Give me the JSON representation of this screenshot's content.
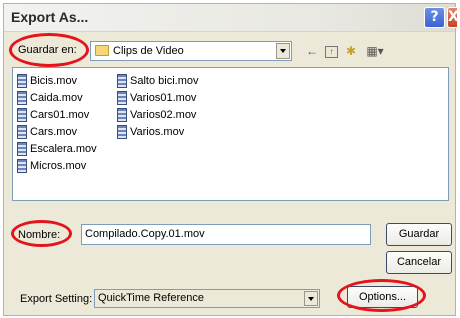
{
  "window": {
    "title": "Export As..."
  },
  "titlebar": {
    "help_glyph": "?",
    "close_glyph": "X"
  },
  "save_in": {
    "label": "Guardar en:",
    "value": "Clips de Video"
  },
  "files": {
    "column1": [
      "Bicis.mov",
      "Caida.mov",
      "Cars01.mov",
      "Cars.mov",
      "Escalera.mov",
      "Micros.mov"
    ],
    "column2": [
      "Salto bici.mov",
      "Varios01.mov",
      "Varios02.mov",
      "Varios.mov"
    ]
  },
  "filename": {
    "label": "Nombre:",
    "value": "Compilado.Copy.01.mov"
  },
  "buttons": {
    "save": "Guardar",
    "cancel": "Cancelar",
    "options": "Options..."
  },
  "export_setting": {
    "label": "Export Setting:",
    "value": "QuickTime Reference"
  },
  "annotations": {
    "color": "#e3141b"
  }
}
